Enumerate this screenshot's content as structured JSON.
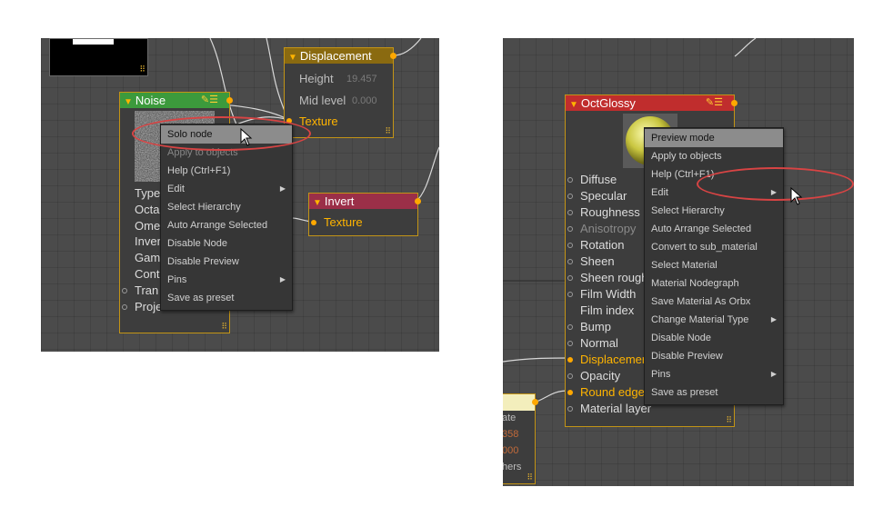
{
  "left": {
    "noise_node": {
      "title": "Noise",
      "params": [
        "Type",
        "Octa",
        "Ome",
        "Inver",
        "Gam",
        "Cont",
        "Tran",
        "Projection"
      ]
    },
    "displacement_node": {
      "title": "Displacement",
      "height_label": "Height",
      "height_value": "19.457",
      "mid_label": "Mid level",
      "mid_value": "0.000",
      "texture_label": "Texture"
    },
    "invert_node": {
      "title": "Invert",
      "texture_label": "Texture"
    },
    "context_menu": {
      "items": [
        {
          "label": "Solo node",
          "selected": true
        },
        {
          "label": "Apply to objects",
          "disabled": true
        },
        {
          "label": "Help (Ctrl+F1)"
        },
        {
          "label": "Edit",
          "submenu": true
        },
        {
          "label": "Select Hierarchy"
        },
        {
          "label": "Auto Arrange Selected"
        },
        {
          "label": "Disable Node"
        },
        {
          "label": "Disable Preview"
        },
        {
          "label": "Pins",
          "submenu": true
        },
        {
          "label": "Save as preset"
        }
      ]
    }
  },
  "right": {
    "octglossy_node": {
      "title": "OctGlossy",
      "params": [
        {
          "label": "Diffuse",
          "pin": "off"
        },
        {
          "label": "Specular",
          "pin": "off"
        },
        {
          "label": "Roughness",
          "pin": "off"
        },
        {
          "label": "Anisotropy",
          "pin": "off",
          "dim": true
        },
        {
          "label": "Rotation",
          "pin": "off"
        },
        {
          "label": "Sheen",
          "pin": "off"
        },
        {
          "label": "Sheen rough",
          "pin": "off"
        },
        {
          "label": "Film Width",
          "pin": "off"
        },
        {
          "label": "Film index",
          "pin": "none"
        },
        {
          "label": "Bump",
          "pin": "off"
        },
        {
          "label": "Normal",
          "pin": "off"
        },
        {
          "label": "Displacemer",
          "pin": "on",
          "highlight": true
        },
        {
          "label": "Opacity",
          "pin": "off"
        },
        {
          "label": "Round edge",
          "pin": "on",
          "highlight": true
        },
        {
          "label": "Material layer",
          "pin": "off"
        }
      ]
    },
    "partial_node": {
      "lines": [
        "ate",
        "358",
        "000",
        "hers"
      ]
    },
    "context_menu": {
      "items": [
        {
          "label": "Preview mode",
          "selected": true
        },
        {
          "label": "Apply to objects"
        },
        {
          "label": "Help (Ctrl+F1)"
        },
        {
          "label": "Edit",
          "submenu": true
        },
        {
          "label": "Select Hierarchy"
        },
        {
          "label": "Auto Arrange Selected"
        },
        {
          "label": "Convert to sub_material"
        },
        {
          "label": "Select Material"
        },
        {
          "label": "Material Nodegraph"
        },
        {
          "label": "Save Material As Orbx"
        },
        {
          "label": "Change Material Type",
          "submenu": true
        },
        {
          "label": "Disable Node"
        },
        {
          "label": "Disable Preview"
        },
        {
          "label": "Pins",
          "submenu": true
        },
        {
          "label": "Save as preset"
        }
      ]
    }
  },
  "colors": {
    "noise_header": "#3c9a3c",
    "displacement_header": "#8a6a10",
    "invert_header": "#9b2f48",
    "octglossy_header": "#c02d2d",
    "pin_active": "#ffa800",
    "annotation": "#d84444"
  },
  "icons": [
    "pin-icon",
    "list-icon",
    "submenu-arrow-icon",
    "resize-corner-icon",
    "cursor-icon"
  ]
}
